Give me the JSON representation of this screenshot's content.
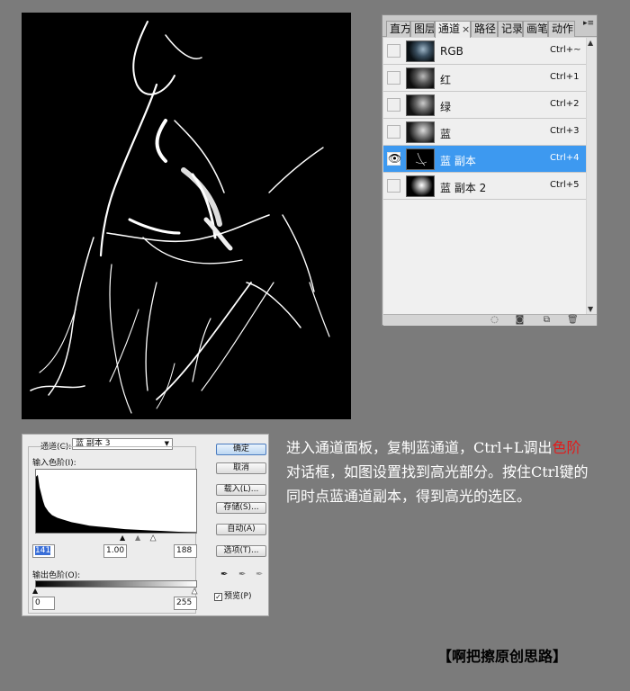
{
  "panel": {
    "tabs": [
      "直方",
      "图层",
      "通道",
      "路径",
      "记录",
      "画笔",
      "动作"
    ],
    "active_tab": "通道",
    "close_glyph": "×",
    "menu_glyph": "▸≡",
    "channels": [
      {
        "name": "RGB",
        "shortcut": "Ctrl+~",
        "visible": false,
        "selected": false
      },
      {
        "name": "红",
        "shortcut": "Ctrl+1",
        "visible": false,
        "selected": false
      },
      {
        "name": "绿",
        "shortcut": "Ctrl+2",
        "visible": false,
        "selected": false
      },
      {
        "name": "蓝",
        "shortcut": "Ctrl+3",
        "visible": false,
        "selected": false
      },
      {
        "name": "蓝 副本",
        "shortcut": "Ctrl+4",
        "visible": true,
        "selected": true
      },
      {
        "name": "蓝 副本 2",
        "shortcut": "Ctrl+5",
        "visible": false,
        "selected": false
      }
    ],
    "footer_icons": [
      "dotted-circle-icon",
      "mask-icon",
      "new-channel-icon",
      "trash-icon"
    ],
    "selected_color": "#3d99f0"
  },
  "levels": {
    "channel_label": "通道(C):",
    "channel_value": "蓝 副本 3",
    "input_levels_label": "输入色阶(I):",
    "input_black": "141",
    "input_gamma": "1.00",
    "input_white": "188",
    "output_levels_label": "输出色阶(O):",
    "output_black": "0",
    "output_white": "255",
    "buttons": {
      "ok": "确定",
      "cancel": "取消",
      "load": "载入(L)...",
      "save": "存储(S)...",
      "auto": "自动(A)",
      "options": "选项(T)..."
    },
    "preview_label": "预览(P)",
    "preview_checked": true
  },
  "description": {
    "part1": "进入通道面板，复制蓝通道，Ctrl+L调出",
    "highlight": "色阶",
    "part2": "对话框，如图设置找到高光部分。按住Ctrl键的同时点蓝通道副本，得到高光的选区。",
    "highlight_color": "#e21b1b"
  },
  "signature": "【啊把擦原创思路】"
}
